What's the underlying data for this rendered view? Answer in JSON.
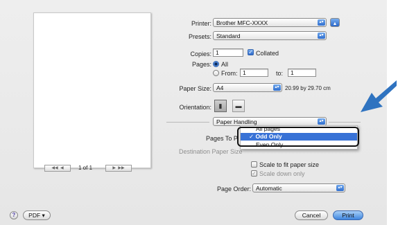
{
  "dialog": {
    "printer_label": "Printer:",
    "printer_value": "Brother MFC-XXXX",
    "presets_label": "Presets:",
    "presets_value": "Standard",
    "copies_label": "Copies:",
    "copies_value": "1",
    "collated_label": "Collated",
    "pages_label": "Pages:",
    "pages_all": "All",
    "pages_from": "From:",
    "from_value": "1",
    "pages_to": "to:",
    "to_value": "1",
    "paper_size_label": "Paper Size:",
    "paper_size_value": "A4",
    "paper_dimensions": "20.99 by 29.70 cm",
    "orientation_label": "Orientation:",
    "section_value": "Paper Handling",
    "pages_to_print_label": "Pages To P",
    "dest_paper_label": "Destination Paper Size",
    "scale_fit_label": "Scale to fit paper size",
    "scale_down_label": "Scale down only",
    "page_order_label": "Page Order:",
    "page_order_value": "Automatic",
    "page_indicator": "1 of 1",
    "help_symbol": "?",
    "pdf_label": "PDF ▾",
    "cancel_label": "Cancel",
    "print_label": "Print"
  },
  "dropdown": {
    "items": [
      "All pages",
      "✓ Odd Only",
      "Even Only"
    ]
  },
  "colors": {
    "accent": "#3872d6",
    "arrow": "#2f73c0"
  },
  "icons": [
    "expand-arrow-icon",
    "portrait-icon",
    "landscape-icon",
    "help-icon",
    "callout-arrow-icon"
  ]
}
